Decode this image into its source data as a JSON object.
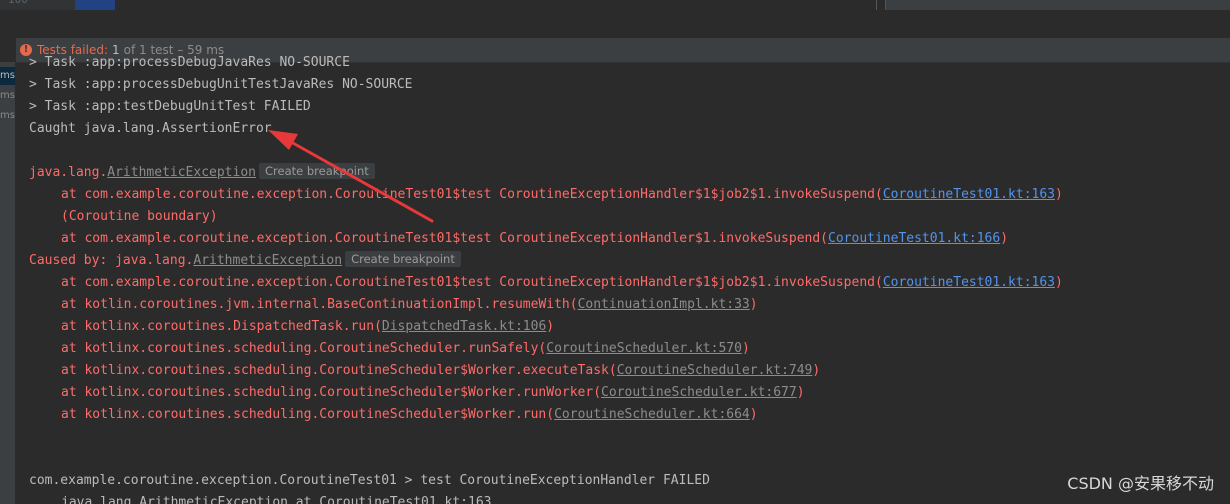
{
  "editor": {
    "line_number": "100"
  },
  "status": {
    "fail_icon": "!",
    "label": "Tests failed:",
    "count": "1",
    "detail": "of 1 test – 59 ms"
  },
  "test_list": {
    "items": [
      "ms",
      "ms",
      "ms"
    ]
  },
  "console": {
    "task_cut": "> Task :app:processDebugJavaRes NO-SOURCE",
    "task1": "> Task :app:processDebugUnitTestJavaRes NO-SOURCE",
    "task2": "> Task :app:testDebugUnitTest FAILED",
    "caught": "Caught java.lang.AssertionError",
    "ex1_prefix": "java.lang.",
    "ex1_name": "ArithmeticException",
    "breakpoint": "Create breakpoint",
    "f1_text": "at com.example.coroutine.exception.CoroutineTest01$test CoroutineExceptionHandler$1$job2$1.invokeSuspend(",
    "f1_link": "CoroutineTest01.kt:163",
    "boundary": "(Coroutine boundary)",
    "f2_text": "at com.example.coroutine.exception.CoroutineTest01$test CoroutineExceptionHandler$1.invokeSuspend(",
    "f2_link": "CoroutineTest01.kt:166",
    "caused_prefix": "Caused by: java.lang.",
    "ex2_name": "ArithmeticException",
    "c1_text": "at com.example.coroutine.exception.CoroutineTest01$test CoroutineExceptionHandler$1$job2$1.invokeSuspend(",
    "c1_link": "CoroutineTest01.kt:163",
    "c2_text": "at kotlin.coroutines.jvm.internal.BaseContinuationImpl.resumeWith(",
    "c2_link": "ContinuationImpl.kt:33",
    "c3_text": "at kotlinx.coroutines.DispatchedTask.run(",
    "c3_link": "DispatchedTask.kt:106",
    "c4_text": "at kotlinx.coroutines.scheduling.CoroutineScheduler.runSafely(",
    "c4_link": "CoroutineScheduler.kt:570",
    "c5_text": "at kotlinx.coroutines.scheduling.CoroutineScheduler$Worker.executeTask(",
    "c5_link": "CoroutineScheduler.kt:749",
    "c6_text": "at kotlinx.coroutines.scheduling.CoroutineScheduler$Worker.runWorker(",
    "c6_link": "CoroutineScheduler.kt:677",
    "c7_text": "at kotlinx.coroutines.scheduling.CoroutineScheduler$Worker.run(",
    "c7_link": "CoroutineScheduler.kt:664",
    "close_paren": ")",
    "summary": "com.example.coroutine.exception.CoroutineTest01 > test CoroutineExceptionHandler FAILED",
    "summary2": "java.lang.ArithmeticException at CoroutineTest01.kt:163"
  },
  "watermark": "CSDN @安果移不动",
  "colors": {
    "error": "#ff6b68",
    "link": "#5394ec",
    "arrow": "#e8393a"
  }
}
